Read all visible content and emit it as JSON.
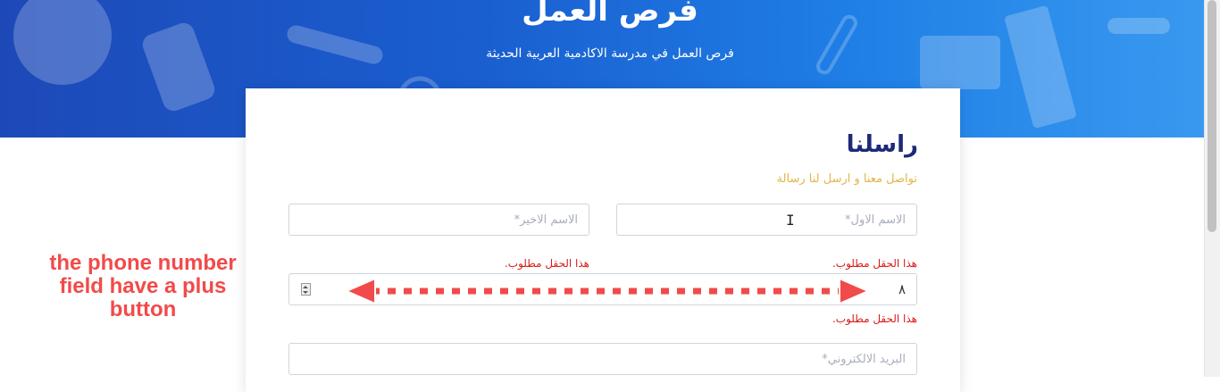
{
  "hero": {
    "title": "فرص العمل",
    "subtitle": "فرص العمل في مدرسة الاكادمية العربية الحديثة"
  },
  "form": {
    "title": "راسلنا",
    "subtitle": "تواصل معنا و ارسل لنا رسالة",
    "first_name_placeholder": "الاسم الاول*",
    "last_name_placeholder": "الاسم الاخير*",
    "first_name_error": "هذا الحقل مطلوب.",
    "last_name_error": "هذا الحقل مطلوب.",
    "phone_value": "٨",
    "phone_error": "هذا الحقل مطلوب.",
    "email_placeholder": "البريد الالكتروني*"
  },
  "annotation": {
    "line1": "the phone number",
    "line2": "field have a plus",
    "line3": "button"
  },
  "colors": {
    "hero_start": "#1d49b8",
    "hero_end": "#3a9af0",
    "title": "#1e2a78",
    "subtitle": "#e2b64a",
    "error": "#d81b1b",
    "annotation": "#f24a4a"
  }
}
